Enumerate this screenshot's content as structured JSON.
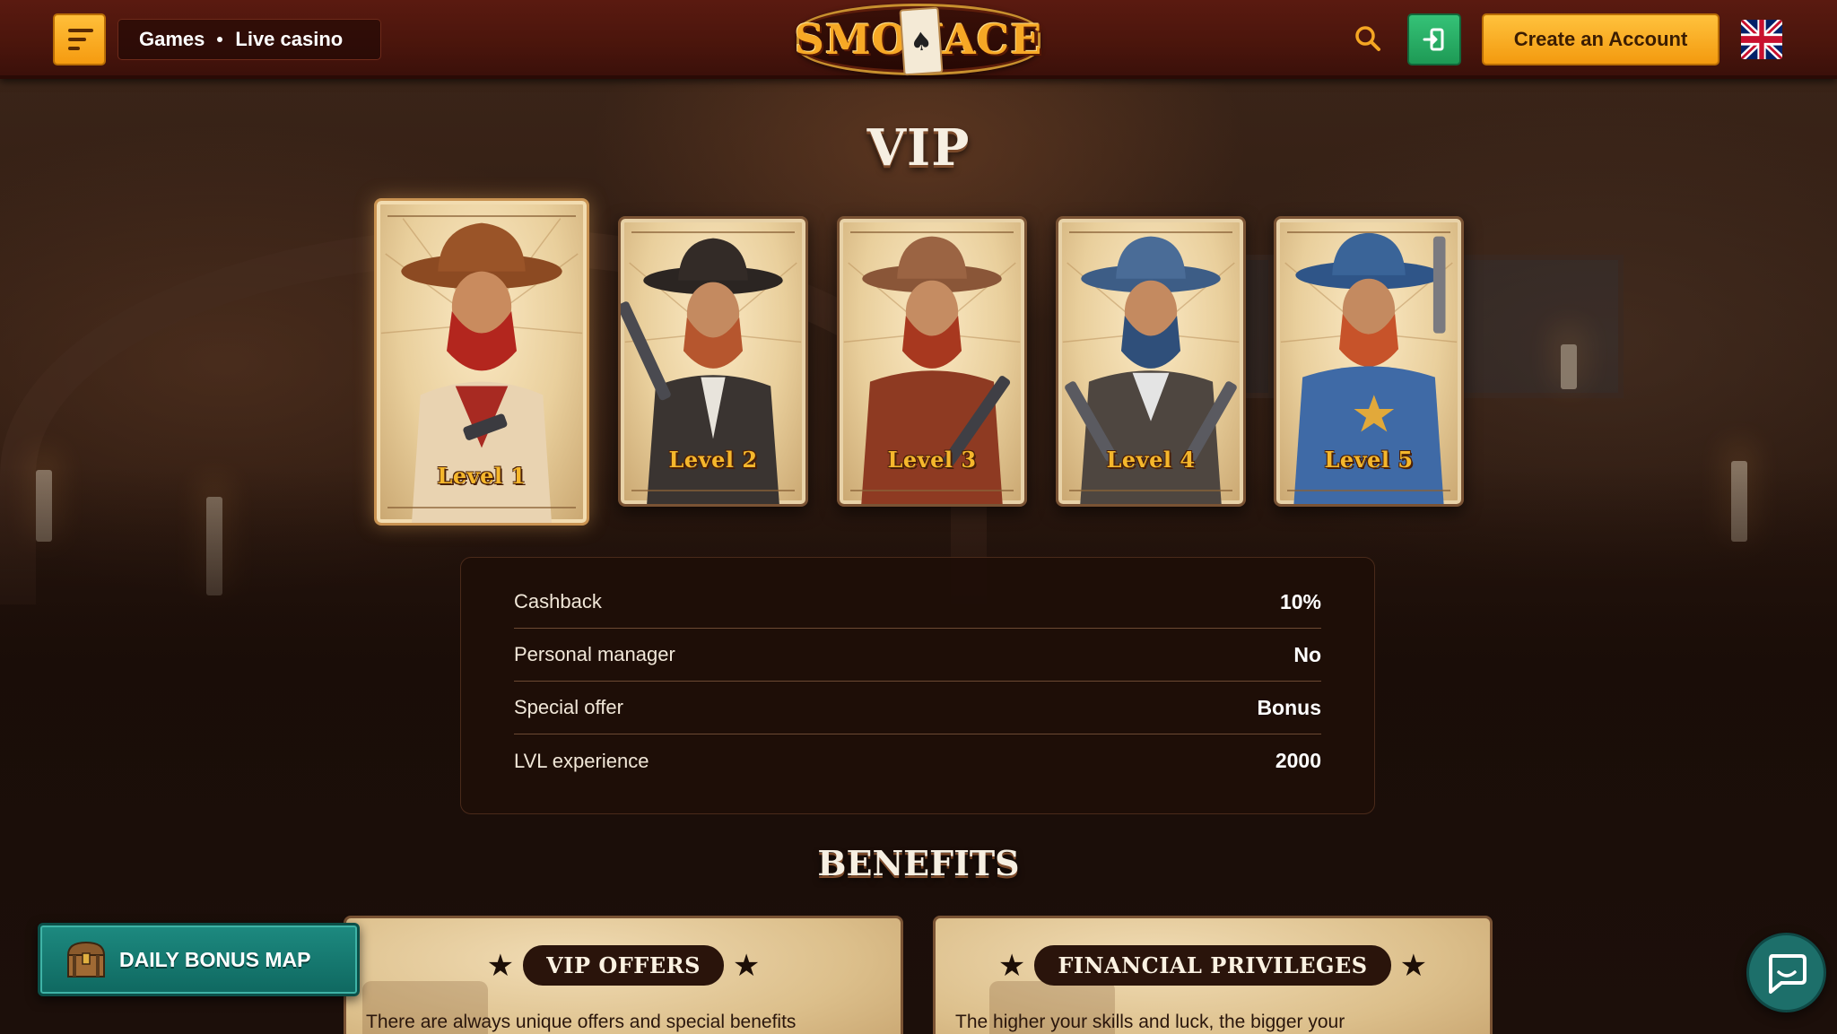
{
  "header": {
    "nav_items": [
      "Games",
      "Live casino"
    ],
    "logo_text": "SMOKACE",
    "create_account_label": "Create an Account",
    "language": "English",
    "icons": {
      "menu": "menu-icon",
      "search": "search-icon",
      "login": "login-icon",
      "flag": "uk-flag-icon"
    },
    "colors": {
      "accent_orange": "#f5a623",
      "login_green": "#28b066",
      "header_red": "#4a150c"
    }
  },
  "vip": {
    "title": "VIP",
    "levels": [
      {
        "label": "Level 1",
        "selected": true
      },
      {
        "label": "Level 2",
        "selected": false
      },
      {
        "label": "Level 3",
        "selected": false
      },
      {
        "label": "Level 4",
        "selected": false
      },
      {
        "label": "Level 5",
        "selected": false
      }
    ],
    "details": [
      {
        "key": "Cashback",
        "value": "10%"
      },
      {
        "key": "Personal manager",
        "value": "No"
      },
      {
        "key": "Special offer",
        "value": "Bonus"
      },
      {
        "key": "LVL experience",
        "value": "2000"
      }
    ]
  },
  "benefits": {
    "title": "BENEFITS",
    "cards": [
      {
        "title": "VIP OFFERS",
        "text": "There are always unique offers and special benefits"
      },
      {
        "title": "FINANCIAL PRIVILEGES",
        "text": "The higher your skills and luck, the bigger your"
      }
    ]
  },
  "widgets": {
    "daily_bonus_label": "DAILY BONUS MAP",
    "chat_icon": "chat-icon"
  }
}
